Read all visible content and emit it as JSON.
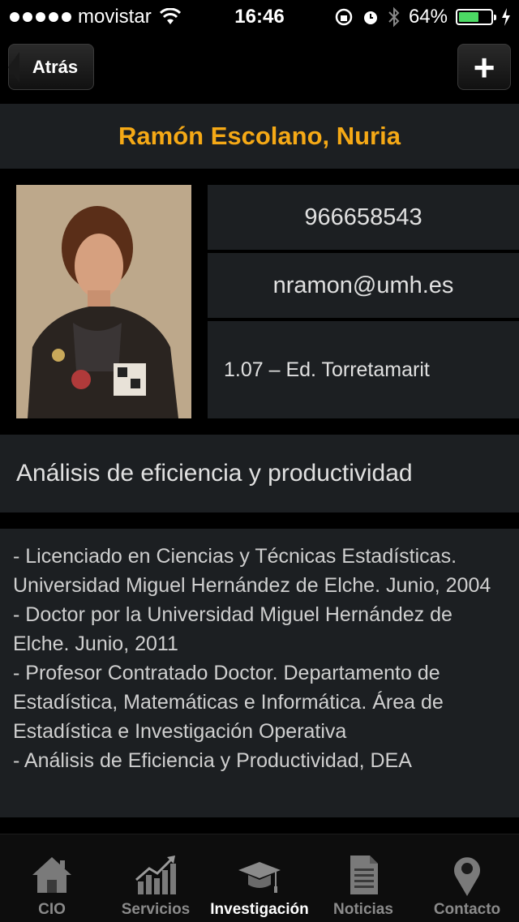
{
  "status_bar": {
    "carrier": "movistar",
    "time": "16:46",
    "battery": "64%",
    "battery_level": 0.64
  },
  "nav": {
    "back_label": "Atrás",
    "add_label": "+"
  },
  "profile": {
    "name": "Ramón Escolano, Nuria",
    "phone": "966658543",
    "email": "nramon@umh.es",
    "office": "1.07 – Ed. Torretamarit",
    "research_area": "Análisis de eficiencia y productividad",
    "bio": [
      "- Licenciado en Ciencias y Técnicas Estadísticas. Universidad Miguel Hernández de Elche. Junio, 2004",
      "- Doctor por la Universidad Miguel Hernández de Elche. Junio, 2011",
      "- Profesor Contratado Doctor. Departamento de Estadística, Matemáticas e Informática. Área de Estadística e Investigación Operativa",
      "- Análisis de Eficiencia y Productividad, DEA"
    ]
  },
  "tabs": [
    {
      "label": "CIO",
      "icon": "house-icon",
      "active": false
    },
    {
      "label": "Servicios",
      "icon": "growth-chart-icon",
      "active": false
    },
    {
      "label": "Investigación",
      "icon": "graduation-cap-icon",
      "active": true
    },
    {
      "label": "Noticias",
      "icon": "document-icon",
      "active": false
    },
    {
      "label": "Contacto",
      "icon": "map-pin-icon",
      "active": false
    }
  ],
  "colors": {
    "accent": "#f5a916",
    "panel": "#1c1f22",
    "battery": "#4cd964"
  }
}
